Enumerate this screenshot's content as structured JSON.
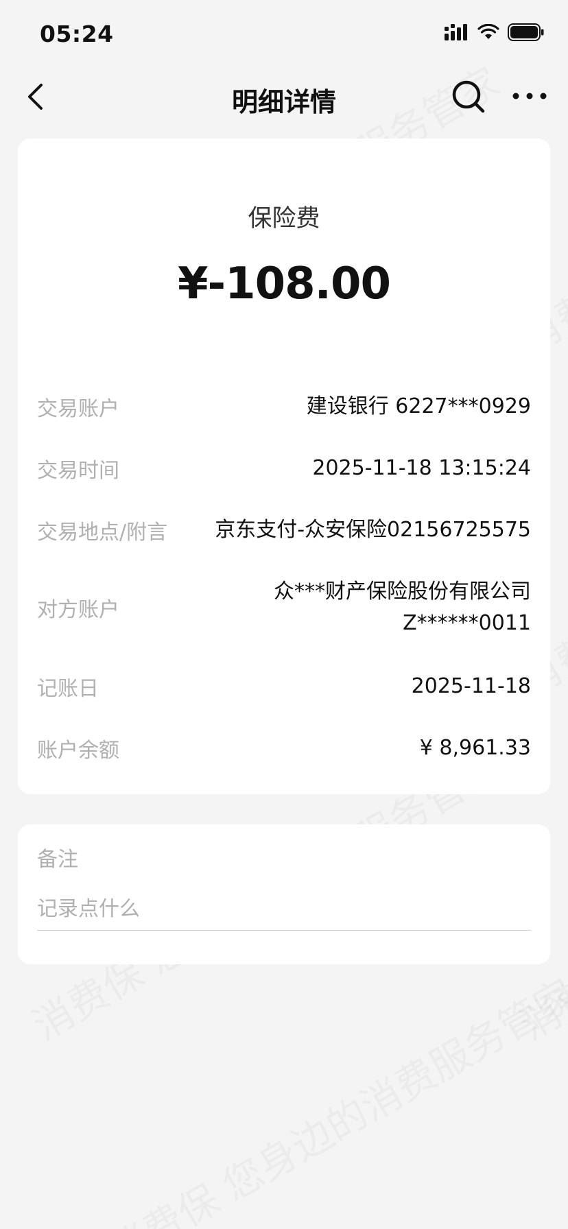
{
  "status": {
    "time": "05:24"
  },
  "nav": {
    "title": "明细详情"
  },
  "summary": {
    "category": "保险费",
    "amount": "¥-108.00"
  },
  "details": [
    {
      "label": "交易账户",
      "value": "建设银行 6227***0929"
    },
    {
      "label": "交易时间",
      "value": "2025-11-18 13:15:24"
    },
    {
      "label": "交易地点/附言",
      "value": "京东支付-众安保险02156725575"
    },
    {
      "label": "对方账户",
      "value": "众***财产保险股份有限公司",
      "value2": "Z******0011"
    },
    {
      "label": "记账日",
      "value": "2025-11-18"
    },
    {
      "label": "账户余额",
      "value": "¥ 8,961.33"
    }
  ],
  "note": {
    "label": "备注",
    "placeholder": "记录点什么"
  }
}
